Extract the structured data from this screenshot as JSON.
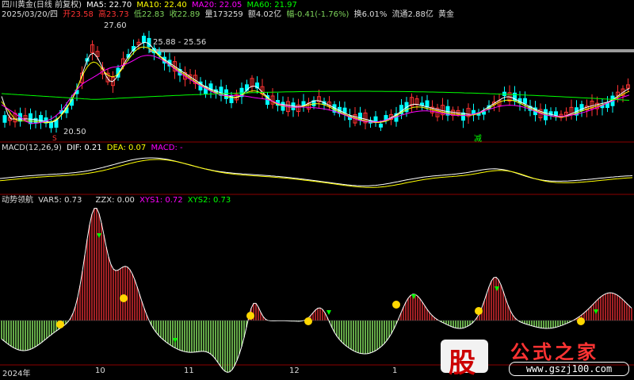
{
  "header": {
    "stock_title": "四川黄金(日线 前复权)",
    "date": "2025/03/20/四",
    "open": "开23.58",
    "high": "高23.73",
    "low": "低22.83",
    "close": "收22.89",
    "volume": "量173259",
    "amount": "额4.02亿",
    "change": "幅-0.41(-1.76%)",
    "turnover": "换6.01%",
    "float": "流通2.88亿",
    "sector": "黄金",
    "ma5": "MA5: 22.70",
    "ma10": "MA10: 22.40",
    "ma20": "MA20: 22.05",
    "ma60": "MA60: 21.97"
  },
  "main_chart": {
    "high_label": "27.60",
    "low_label": "20.50",
    "range_label": "25.88 - 25.56",
    "mark_s": "S",
    "mark_jian": "减"
  },
  "macd": {
    "title": "MACD(12,26,9)",
    "dif": "DIF: 0.21",
    "dea": "DEA: 0.07",
    "macd": "MACD: -"
  },
  "indicator": {
    "title": "动势领航",
    "var5": "VAR5: 0.73",
    "zzx": "ZZX: 0.00",
    "xys1": "XYS1: 0.72",
    "xys2": "XYS2: 0.73"
  },
  "xaxis": {
    "labels": [
      "2024年",
      "10",
      "11",
      "12",
      "1"
    ]
  },
  "watermark": {
    "gu": "股",
    "title": "公式之家",
    "url": "www.gszj100.com"
  },
  "colors": {
    "up": "#ff3232",
    "down": "#00ffff",
    "ma5": "#ffffff",
    "ma10": "#ffff00",
    "ma20": "#ff00ff",
    "ma60": "#00ff00",
    "hist_up": "#c8282d",
    "hist_down": "#7dd35a"
  }
}
